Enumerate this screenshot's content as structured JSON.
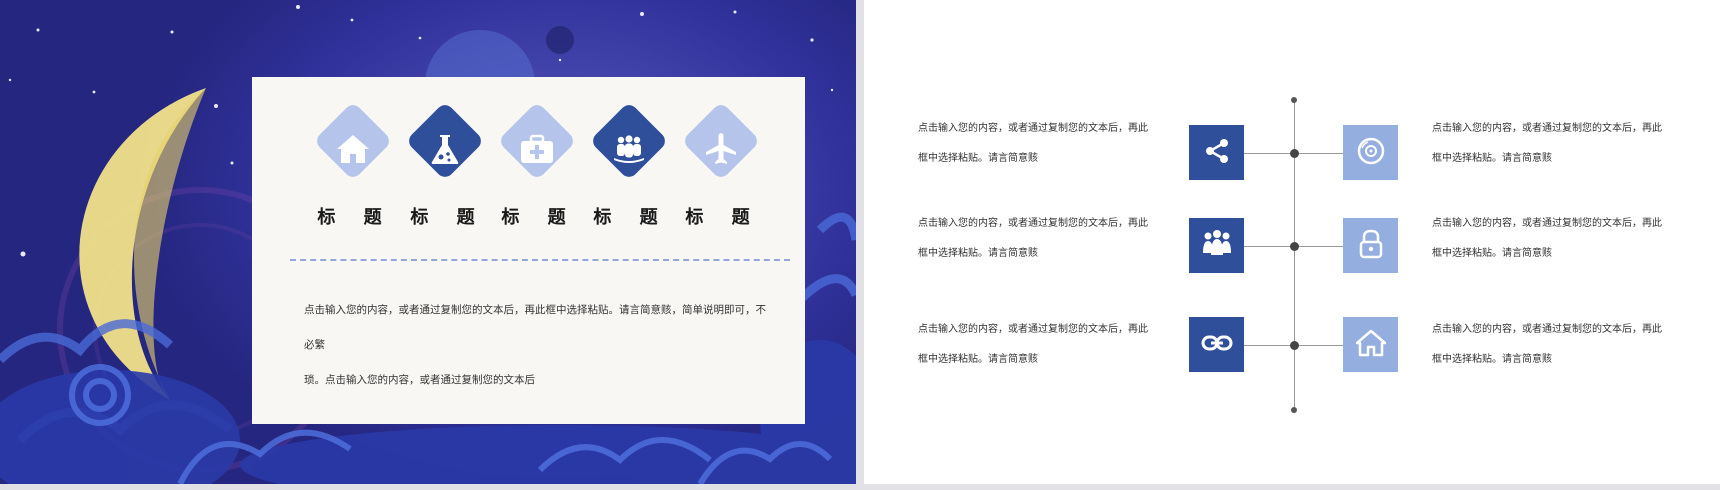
{
  "left_slide": {
    "titles": [
      "标 题",
      "标 题",
      "标 题",
      "标 题",
      "标 题"
    ],
    "icons": [
      "home-icon",
      "flask-icon",
      "medical-kit-icon",
      "team-icon",
      "airplane-icon"
    ],
    "body_line1": "点击输入您的内容，或者通过复制您的文本后，再此框中选择粘贴。请言简意赅，简单说明即可，不必繁",
    "body_line2": "琐。点击输入您的内容，或者通过复制您的文本后"
  },
  "right_slide": {
    "rows": [
      {
        "left_text_line1": "点击输入您的内容，或者通过复制您的文本后，再此",
        "left_text_line2": "框中选择粘贴。请言简意赅",
        "left_icon": "share-icon",
        "right_icon": "disc-icon",
        "right_text_line1": "点击输入您的内容，或者通过复制您的文本后，再此",
        "right_text_line2": "框中选择粘贴。请言简意赅"
      },
      {
        "left_text_line1": "点击输入您的内容，或者通过复制您的文本后，再此",
        "left_text_line2": "框中选择粘贴。请言简意赅",
        "left_icon": "team-icon",
        "right_icon": "lock-icon",
        "right_text_line1": "点击输入您的内容，或者通过复制您的文本后，再此",
        "right_text_line2": "框中选择粘贴。请言简意赅"
      },
      {
        "left_text_line1": "点击输入您的内容，或者通过复制您的文本后，再此",
        "left_text_line2": "框中选择粘贴。请言简意赅",
        "left_icon": "link-icon",
        "right_icon": "home-icon",
        "right_text_line1": "点击输入您的内容，或者通过复制您的文本后，再此",
        "right_text_line2": "框中选择粘贴。请言简意赅"
      }
    ]
  },
  "colors": {
    "dark_blue": "#2f4f9a",
    "light_blue": "#94aee0",
    "diamond_light": "#b5c4ea",
    "night_bg": "#30319a",
    "moon": "#f1e28a"
  }
}
